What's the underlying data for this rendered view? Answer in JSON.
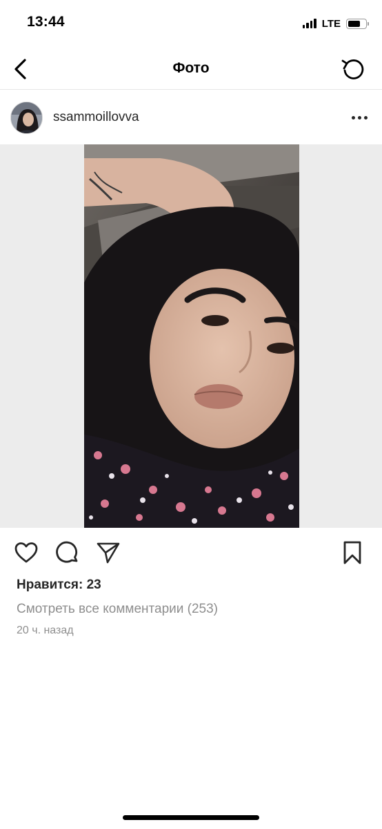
{
  "status_bar": {
    "time": "13:44",
    "carrier": "LTE",
    "signal_icon": "signal-bars-icon",
    "battery_icon": "battery-icon",
    "battery_level": 0.75
  },
  "nav": {
    "title": "Фото",
    "back_icon": "chevron-left-icon",
    "refresh_icon": "refresh-icon"
  },
  "post": {
    "username": "ssammoillovva",
    "more_icon": "more-horizontal-icon",
    "actions": {
      "like_icon": "heart-icon",
      "comment_icon": "comment-icon",
      "share_icon": "send-icon",
      "save_icon": "bookmark-icon"
    },
    "likes_text": "Нравится: 23",
    "view_comments_text": "Смотреть все комментарии (253)",
    "time_ago": "20 ч. назад"
  },
  "colors": {
    "text_primary": "#262626",
    "text_secondary": "#8e8e8e",
    "divider": "#e6e6e6",
    "media_background": "#ececec"
  }
}
